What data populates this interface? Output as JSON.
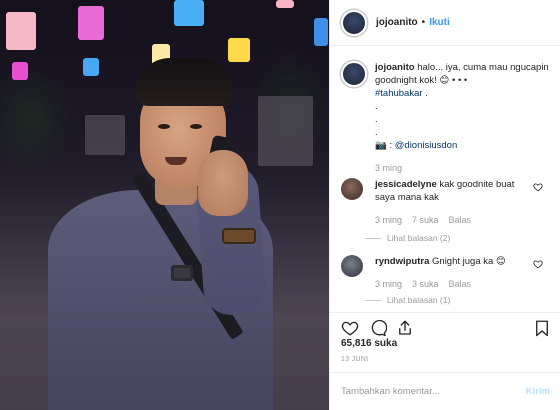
{
  "post": {
    "username": "jojoanito",
    "follow_separator": "•",
    "follow_label": "Ikuti"
  },
  "caption": {
    "username": "jojoanito",
    "text": "halo... iya, cuma mau ngucapin goodnight kok! 😊 • • •",
    "hashtag": "#tahubakar",
    "after_hashtag": ".",
    "dots": [
      ".",
      ".",
      "."
    ],
    "credit_icon": "📷",
    "credit_prefix": " : ",
    "credit_mention": "@dionisiusdon",
    "time": "3 ming"
  },
  "comments": [
    {
      "username": "jessicadelyne",
      "text": "kak goodnite buat saya mana kak",
      "time": "3 ming",
      "likes": "7 suka",
      "reply_label": "Balas",
      "view_replies": "Lihat balasan (2)"
    },
    {
      "username": "ryndwiputra",
      "text": "Gnight juga ka 😊",
      "time": "3 ming",
      "likes": "3 suka",
      "reply_label": "Balas",
      "view_replies": "Lihat balasan (1)"
    }
  ],
  "actions": {
    "like_icon": "heart-icon",
    "comment_icon": "comment-icon",
    "share_icon": "share-icon",
    "save_icon": "bookmark-icon"
  },
  "likes_count": "65,816 suka",
  "date": "13 JUNI",
  "add_comment": {
    "placeholder": "Tambahkan komentar...",
    "post_label": "Kirim"
  },
  "colors": {
    "link": "#3897f0",
    "hashtag": "#003569",
    "muted": "#999999",
    "post_disabled": "#b2dffc"
  }
}
